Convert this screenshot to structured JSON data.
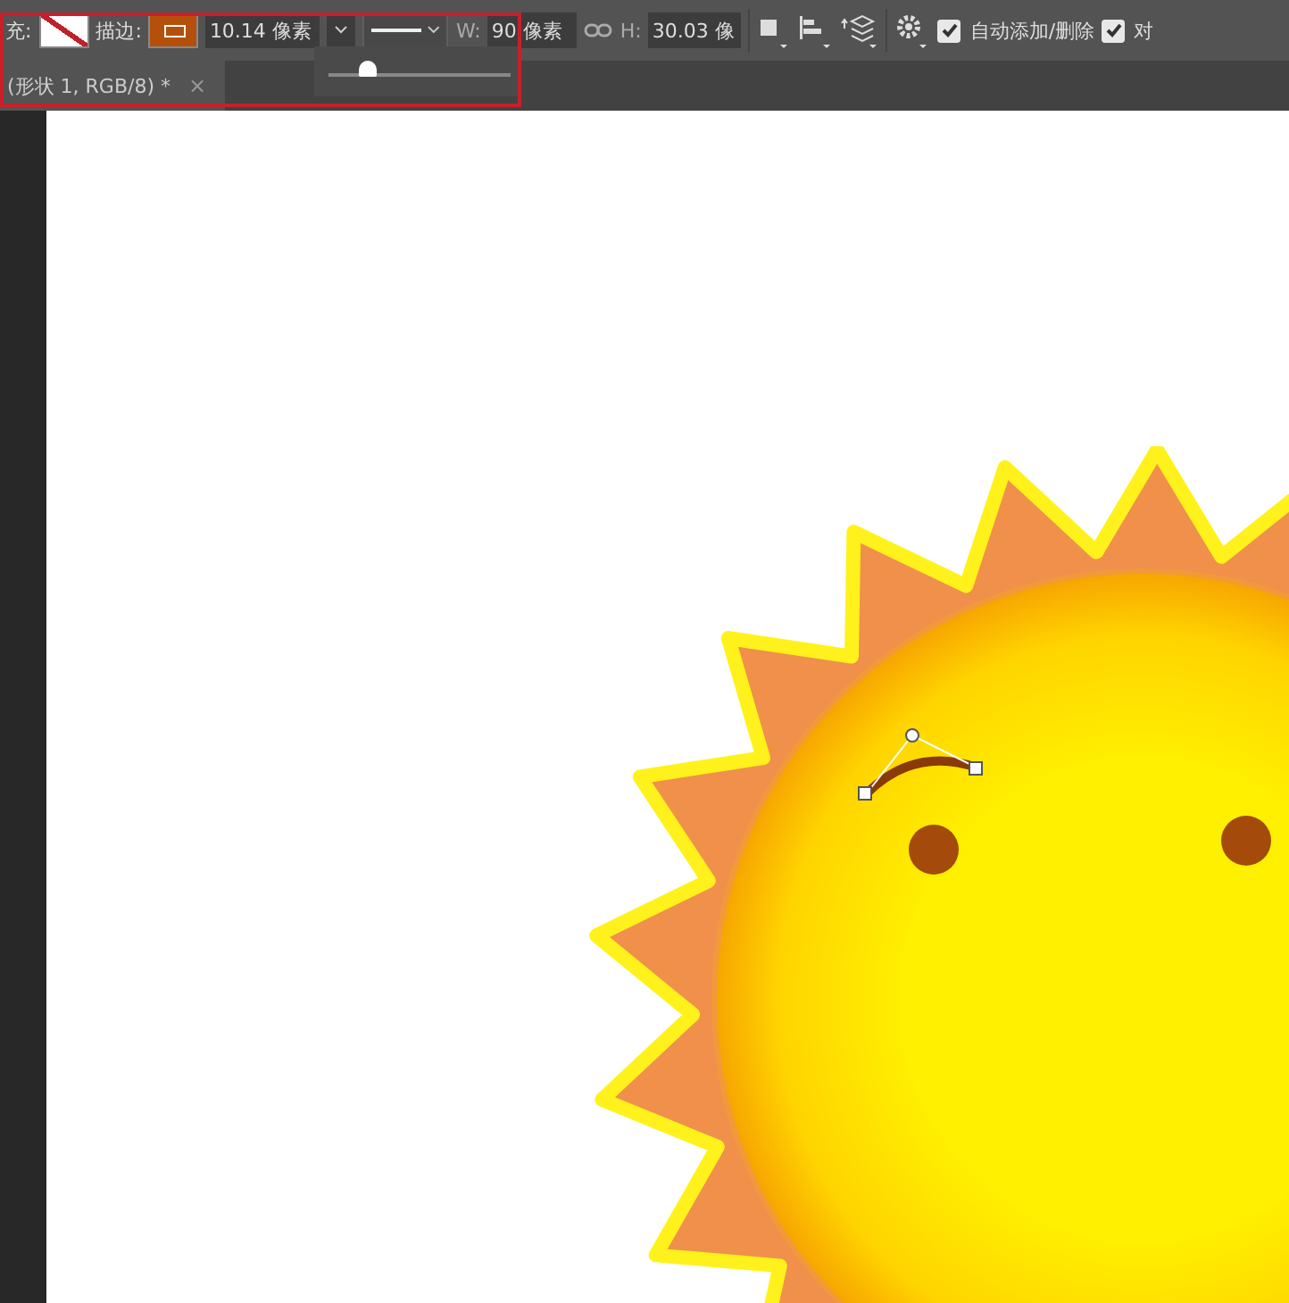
{
  "toolbar": {
    "fill_label": "充:",
    "stroke_label": "描边:",
    "stroke_width": "10.14 像素",
    "w_label": "W:",
    "w_value": "90 像素",
    "h_label": "H:",
    "h_value": "30.03 像",
    "checkboxes": [
      {
        "label": "自动添加/删除",
        "checked": true
      },
      {
        "label": "对",
        "checked": true
      }
    ]
  },
  "stroke_popup": {
    "level": 0.22
  },
  "tabs": [
    {
      "label": "(形状 1, RGB/8) *",
      "selected": true,
      "close": "×"
    }
  ]
}
